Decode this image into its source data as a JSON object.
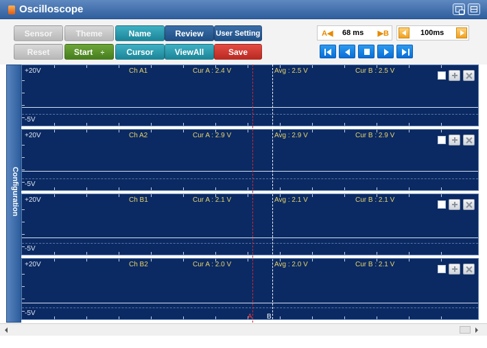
{
  "window": {
    "title": "Oscilloscope"
  },
  "toolbar": {
    "row1": [
      "Sensor",
      "Theme",
      "Name",
      "Review",
      "User Setting"
    ],
    "row2": [
      "Reset",
      "Start",
      "Cursor",
      "ViewAll",
      "Save"
    ],
    "start_arrows": "÷"
  },
  "time": {
    "cursor_a_label": "A◀",
    "cursor_b_label": "▶B",
    "delta": "68 ms",
    "interval": "100ms"
  },
  "side_panel": {
    "label": "Configuration"
  },
  "channels": [
    {
      "name": "Ch A1",
      "max": "+20V",
      "min": "-5V",
      "cur_a": "Cur A : 2.4 V",
      "avg": "Avg : 2.5 V",
      "cur_b": "Cur B : 2.5 V"
    },
    {
      "name": "Ch A2",
      "max": "+20V",
      "min": "-5V",
      "cur_a": "Cur A : 2.9 V",
      "avg": "Avg : 2.9 V",
      "cur_b": "Cur B : 2.9 V"
    },
    {
      "name": "Ch B1",
      "max": "+20V",
      "min": "-5V",
      "cur_a": "Cur A : 2.1 V",
      "avg": "Avg : 2.1 V",
      "cur_b": "Cur B : 2.1 V"
    },
    {
      "name": "Ch B2",
      "max": "+20V",
      "min": "-5V",
      "cur_a": "Cur A : 2.0 V",
      "avg": "Avg : 2.0 V",
      "cur_b": "Cur B : 2.1 V"
    }
  ],
  "cursors": {
    "a": "A",
    "b": "B"
  },
  "colors": {
    "plot_bg": "#0b2a63",
    "readout": "#e8d46a",
    "cursor_a": "#d12a2a",
    "cursor_b": "#ffffff"
  }
}
